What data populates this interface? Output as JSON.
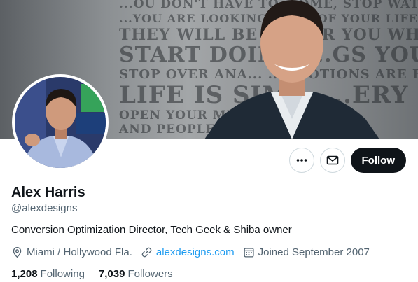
{
  "banner": {
    "lines": [
      "...OU DON'T HAVE TO ...OME, STOP WATCHIN",
      "...YOU ARE LOOKING ...AVE OF YOUR LIFE,",
      "THEY WILL BE W... ...R YOU WHEN",
      "START DOIN... ...GS YOU LO",
      "STOP OVER ANA... ...EMOTIONS ARE BEAU",
      "LIFE IS SIM... ...ERY LAST B",
      "OPEN YOUR MIND ... ...NEW TH",
      "AND PEOPLE ... ...IFFEREN"
    ]
  },
  "profile": {
    "name": "Alex Harris",
    "handle": "@alexdesigns",
    "bio": "Conversion Optimization Director, Tech Geek & Shiba owner",
    "location": "Miami / Hollywood Fla.",
    "website": "alexdesigns.com",
    "joined": "Joined September 2007"
  },
  "actions": {
    "more_icon": "more-icon",
    "message_icon": "envelope-icon",
    "follow_label": "Follow"
  },
  "stats": {
    "following_count": "1,208",
    "following_label": "Following",
    "followers_count": "7,039",
    "followers_label": "Followers"
  },
  "colors": {
    "link": "#1d9bf0",
    "secondary_text": "#536471",
    "primary_text": "#0f1419",
    "follow_button": "#0f1419"
  }
}
